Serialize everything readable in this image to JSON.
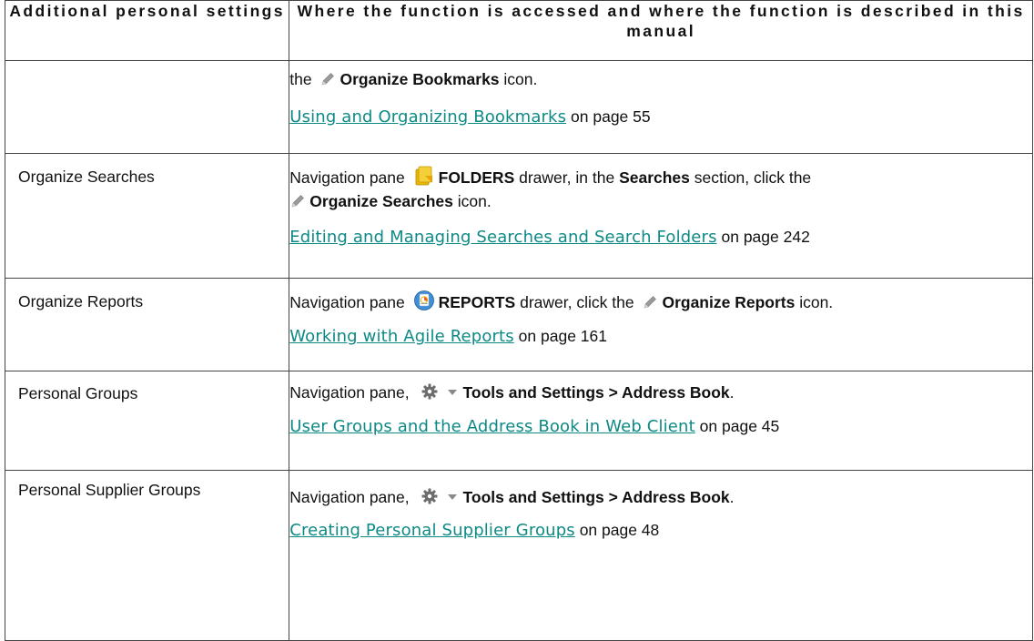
{
  "table": {
    "header": {
      "col1": "Additional personal settings",
      "col2": "Where the function is accessed and where the function is described in this manual"
    },
    "rows": [
      {
        "setting": "",
        "p1": {
          "pre": "the",
          "bold": "Organize Bookmarks",
          "post": "icon."
        },
        "link": {
          "text": "Using and Organizing Bookmarks",
          "suffix": "on page 55"
        }
      },
      {
        "setting": "Organize Searches",
        "p1": {
          "pre": "Navigation pane",
          "bold1": "FOLDERS",
          "mid1": "drawer, in the",
          "bold2": "Searches",
          "mid2": "section, click the",
          "bold3": "Organize Searches",
          "post": "icon."
        },
        "link": {
          "text": "Editing and Managing Searches and Search Folders",
          "suffix": "on page 242"
        }
      },
      {
        "setting": "Organize Reports",
        "p1": {
          "pre": "Navigation pane",
          "bold1": "REPORTS",
          "mid1": "drawer, click the",
          "bold2": "Organize Reports",
          "post": "icon."
        },
        "link": {
          "text": "Working with Agile Reports",
          "suffix": "on page 161"
        }
      },
      {
        "setting": "Personal Groups",
        "p1": {
          "pre": "Navigation pane,",
          "bold": "Tools and Settings > Address Book",
          "post": "."
        },
        "link": {
          "text": "User Groups and the Address Book in Web Client",
          "suffix": "on page 45"
        }
      },
      {
        "setting": "Personal Supplier Groups",
        "p1": {
          "pre": "Navigation pane,",
          "bold": "Tools and Settings > Address Book",
          "post": "."
        },
        "link": {
          "text": "Creating Personal Supplier Groups",
          "suffix": "on page 48"
        }
      }
    ]
  },
  "icons": {
    "pencil": "pencil-icon",
    "folders": "folder-icon",
    "reports": "report-icon",
    "gear": "gear-icon",
    "caret": "caret-down-icon"
  },
  "colors": {
    "link": "#0d8a86",
    "border": "#444444"
  }
}
